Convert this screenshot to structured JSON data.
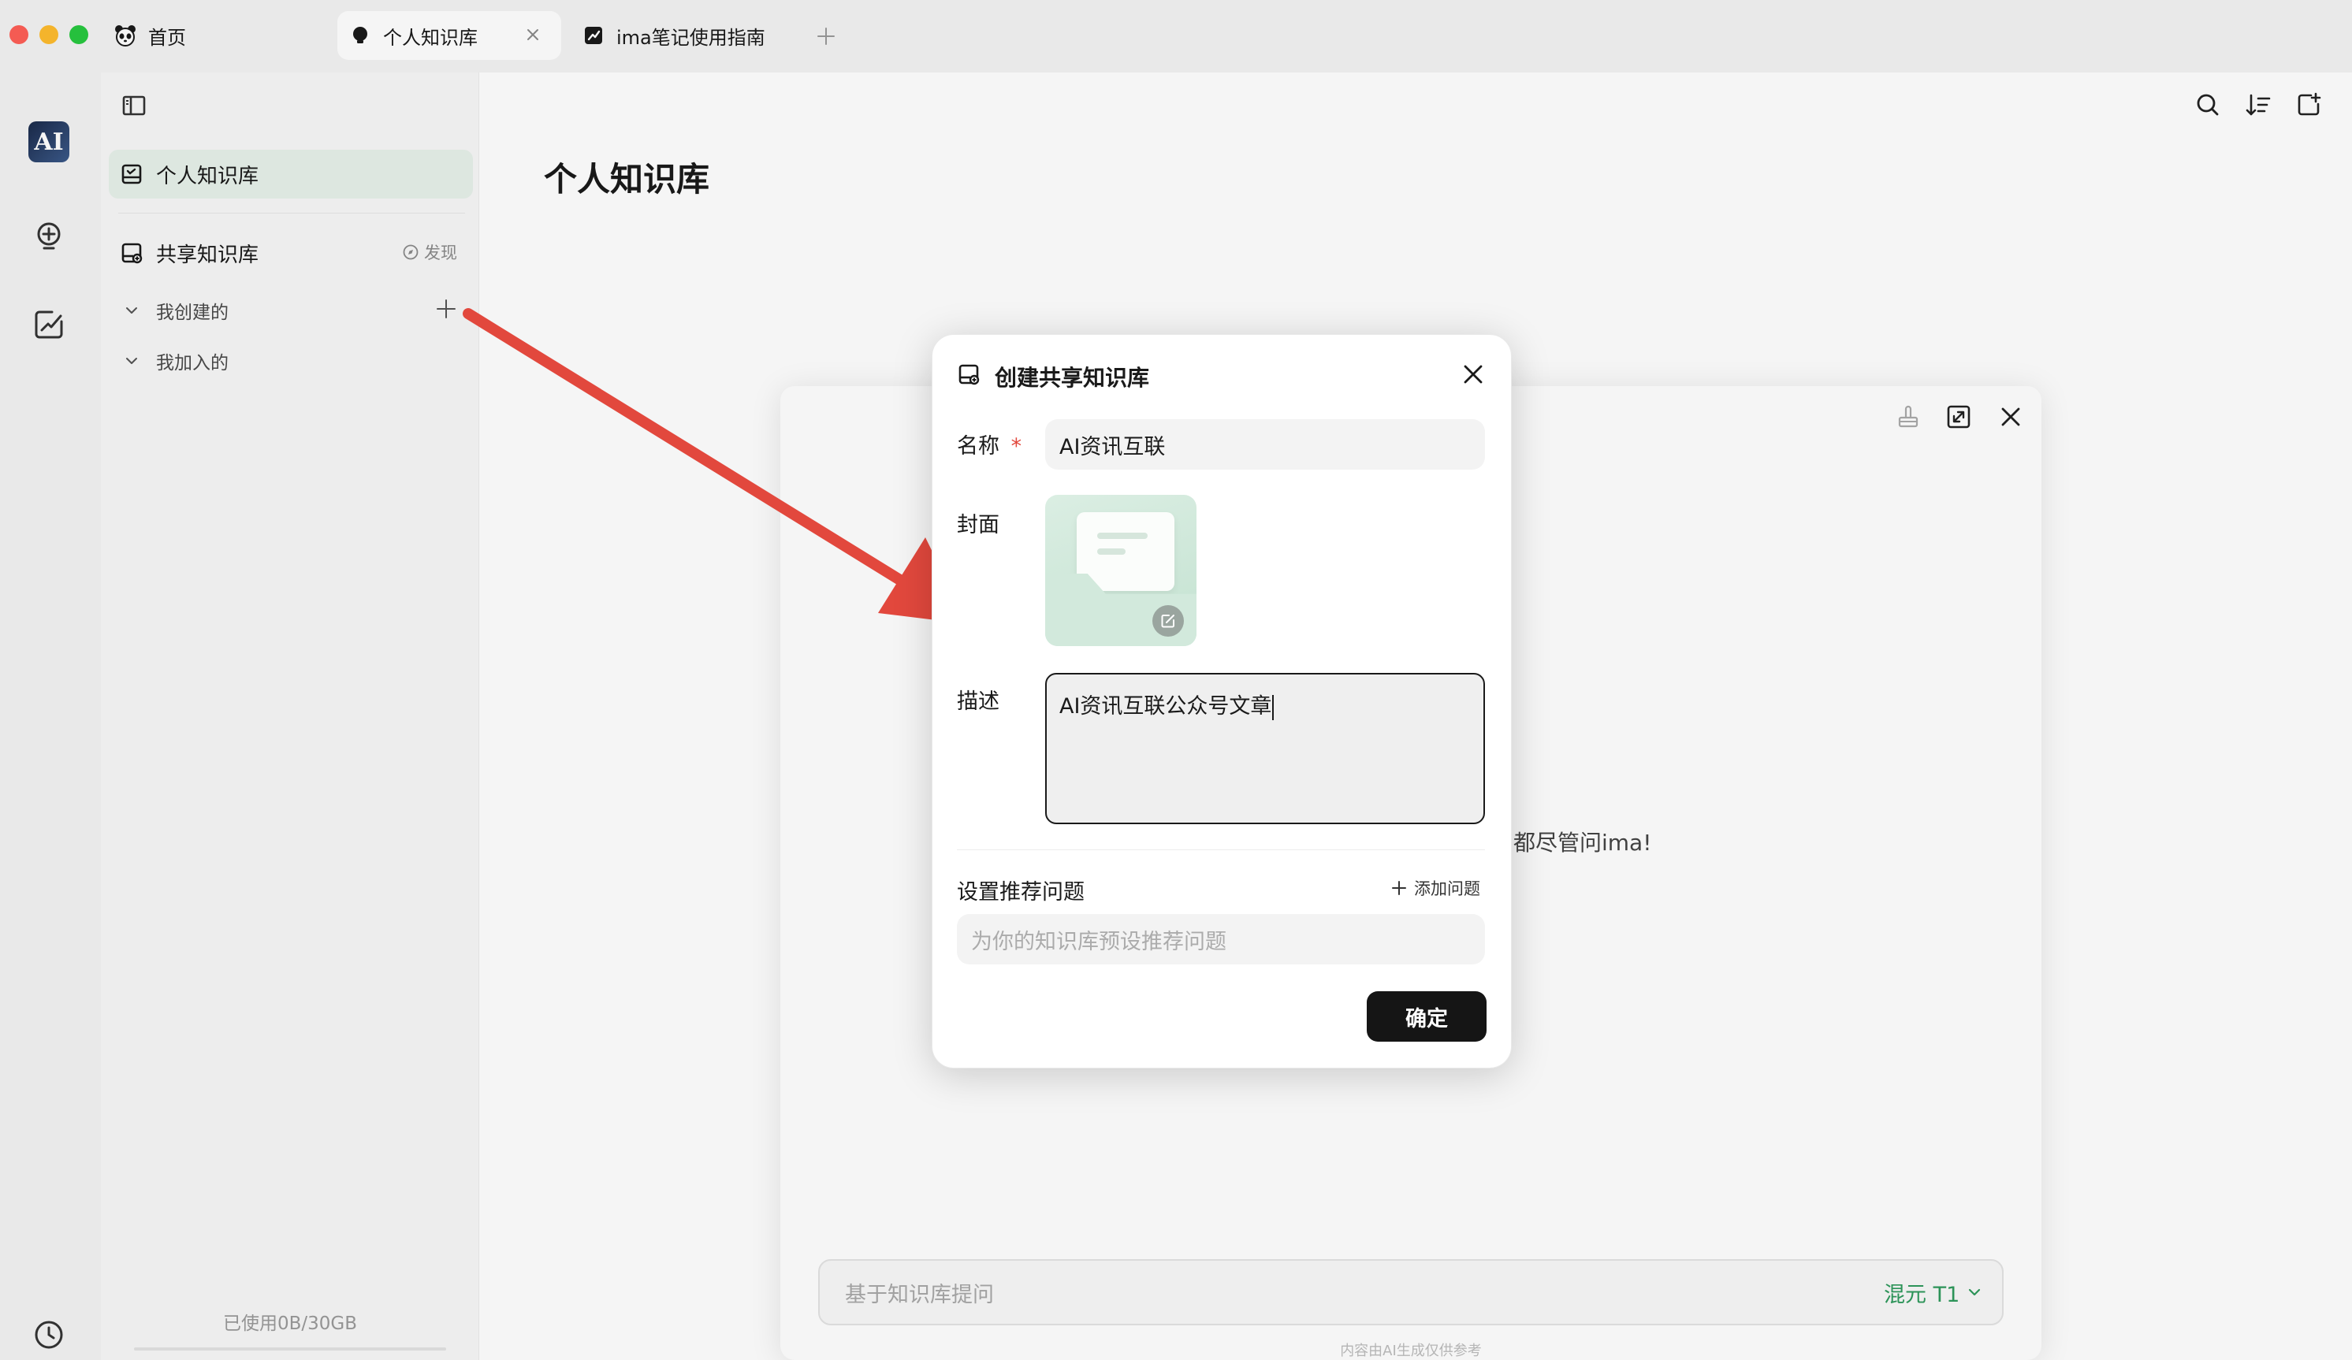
{
  "tabs": [
    {
      "label": "首页"
    },
    {
      "label": "个人知识库"
    },
    {
      "label": "ima笔记使用指南"
    }
  ],
  "rail": {
    "avatar_text": "AI"
  },
  "sidebar": {
    "personal_kb": "个人知识库",
    "shared_kb": "共享知识库",
    "discover": "发现",
    "created_by_me": "我创建的",
    "joined": "我加入的",
    "storage_used": "已使用0B/30GB"
  },
  "main": {
    "page_title": "个人知识库",
    "hint_text": "都尽管问ima!",
    "ask_placeholder": "基于知识库提问",
    "model_label": "混元 T1",
    "disclaimer": "内容由AI生成仅供参考"
  },
  "dialog": {
    "title": "创建共享知识库",
    "name_label": "名称",
    "required_mark": "*",
    "name_value": "AI资讯互联",
    "cover_label": "封面",
    "desc_label": "描述",
    "desc_value": "AI资讯互联公众号文章",
    "recommend_label": "设置推荐问题",
    "add_question": "添加问题",
    "question_placeholder": "为你的知识库预设推荐问题",
    "confirm": "确定"
  },
  "colors": {
    "accent_green": "#2e9a5c",
    "active_item_bg": "#e6f1ea",
    "arrow_red": "#e2483d",
    "confirm_bg": "#151515"
  }
}
